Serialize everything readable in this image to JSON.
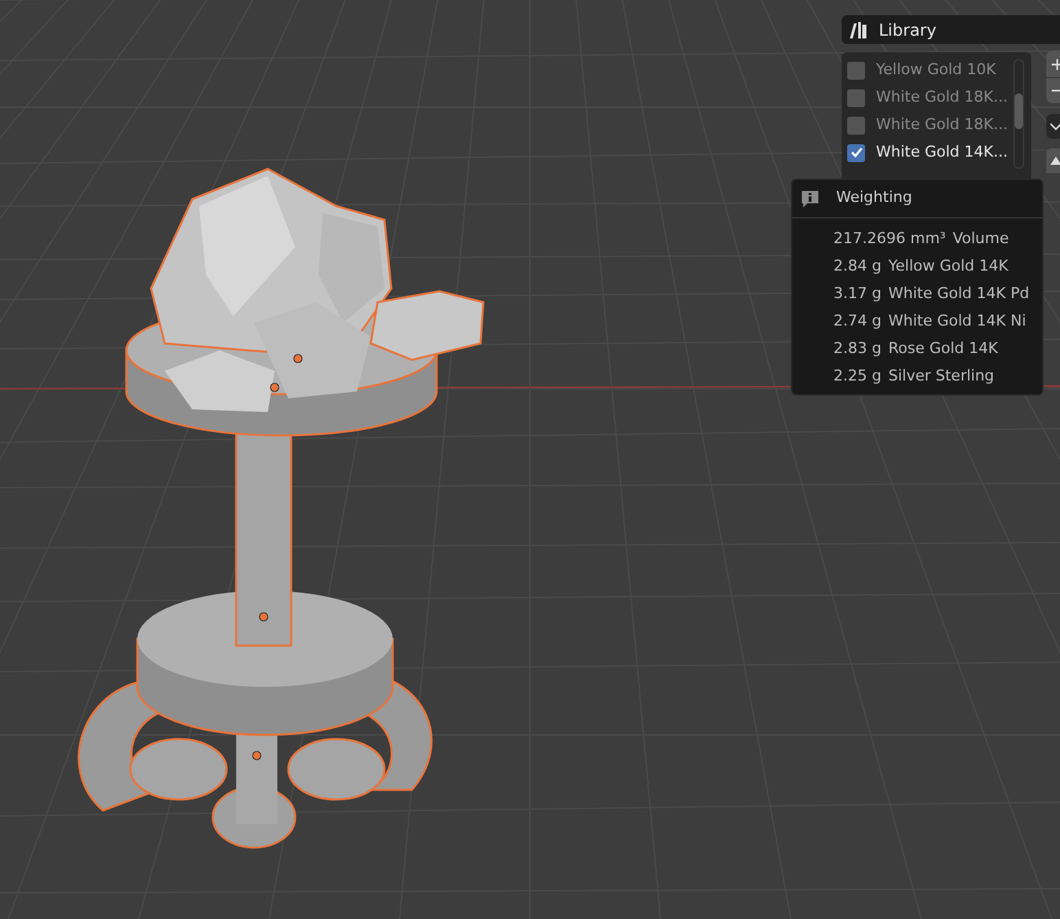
{
  "library": {
    "title": "Library",
    "items": [
      {
        "label": "Yellow Gold 10K",
        "checked": false
      },
      {
        "label": "White Gold 18K...",
        "checked": false
      },
      {
        "label": "White Gold 18K...",
        "checked": false
      },
      {
        "label": "White Gold 14K...",
        "checked": true
      }
    ]
  },
  "tooltip": {
    "title": "Weighting",
    "lines": [
      {
        "value": "217.2696 mm³",
        "label": "Volume"
      },
      {
        "value": "2.84 g",
        "label": "Yellow Gold 14K"
      },
      {
        "value": "3.17 g",
        "label": "White Gold 14K Pd"
      },
      {
        "value": "2.74 g",
        "label": "White Gold 14K Ni"
      },
      {
        "value": "2.83 g",
        "label": "Rose Gold 14K"
      },
      {
        "value": "2.25 g",
        "label": "Silver Sterling"
      }
    ]
  }
}
